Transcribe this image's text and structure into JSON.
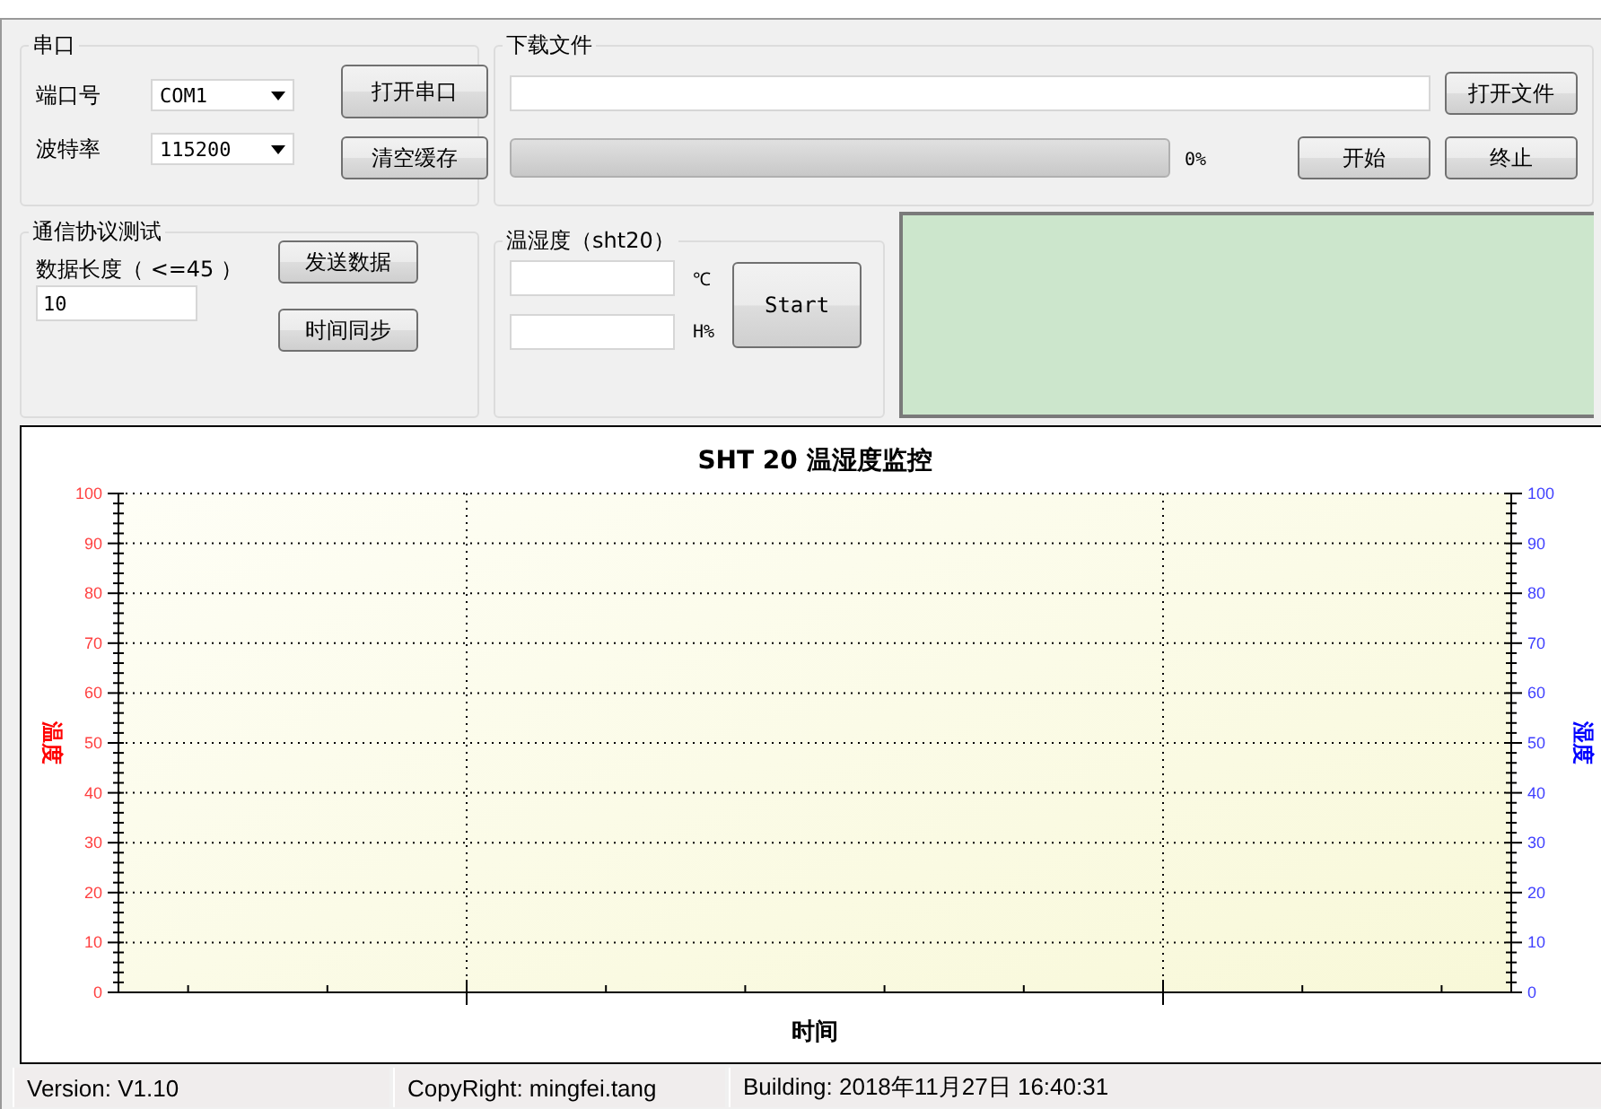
{
  "serial": {
    "title": "串口",
    "port_label": "端口号",
    "port": "COM1",
    "baud_label": "波特率",
    "baud": "115200",
    "buttons": [
      "打开串口",
      "清空缓存"
    ]
  },
  "download": {
    "title": "下载文件",
    "open_button": "打开文件",
    "progress": {
      "level": 0
    },
    "percent": "0%",
    "buttons": [
      "开始",
      "终止"
    ]
  },
  "protocol": {
    "title": "通信协议测试",
    "length_label": "数据长度（ <=45 ）",
    "length": "10",
    "buttons": [
      "发送数据",
      "时间同步"
    ]
  },
  "sensor": {
    "title": "温湿度（sht20）",
    "fields": [
      {
        "unit": "℃"
      },
      {
        "unit": "H%"
      }
    ],
    "button": "Start"
  },
  "chart": {
    "chart_data": {
      "type": "line",
      "title": "SHT 20 温湿度监控",
      "xlabel": "时间",
      "categories": [
        null,
        null,
        null,
        null,
        null,
        null,
        null,
        null,
        null,
        null
      ],
      "series": [
        {
          "values": [
            null,
            null,
            null,
            null,
            null,
            null,
            null,
            null,
            null,
            null
          ]
        }
      ],
      "ylabel": "温度",
      "ylim": [
        0,
        100
      ],
      "yticks": [
        0,
        10,
        20,
        30,
        40,
        50,
        60,
        70,
        80,
        90,
        100
      ],
      "grid": true,
      "y2label": "湿度",
      "y2lim": [
        0,
        100
      ],
      "y2ticks": [
        0,
        10,
        20,
        30,
        40,
        50,
        60,
        70,
        80,
        90,
        100
      ]
    }
  },
  "status_bar": [
    "Version: V1.10",
    "CopyRight: mingfei.tang",
    "Building: 2018年11月27日 16:40:31"
  ]
}
